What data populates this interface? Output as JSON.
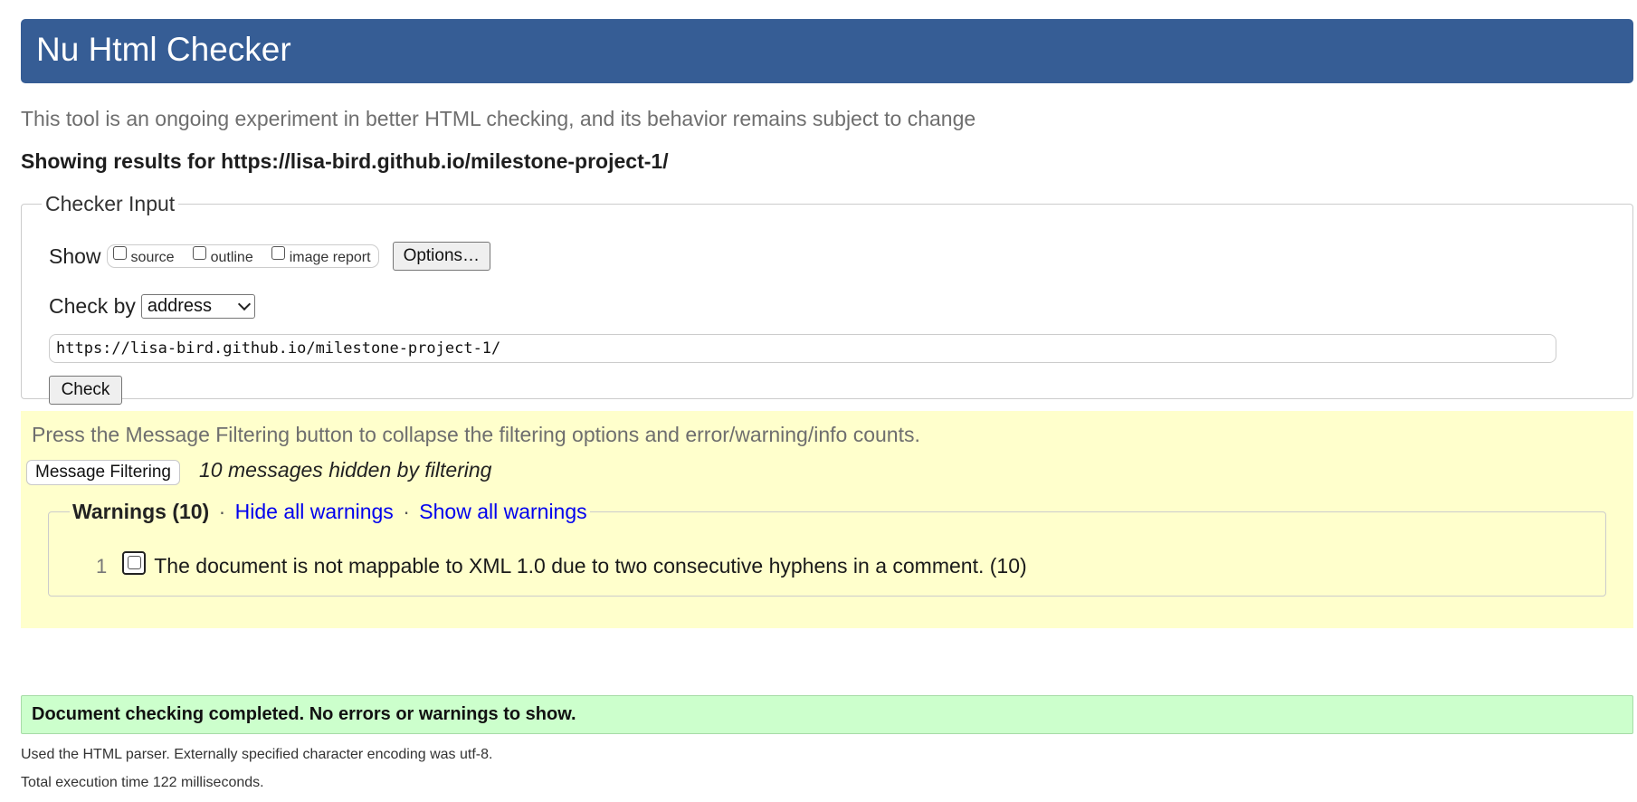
{
  "header": {
    "title": "Nu Html Checker"
  },
  "tagline": "This tool is an ongoing experiment in better HTML checking, and its behavior remains subject to change",
  "results_heading": "Showing results for https://lisa-bird.github.io/milestone-project-1/",
  "checker_input": {
    "legend": "Checker Input",
    "show_label": "Show",
    "show_options": [
      {
        "label": "source",
        "checked": false
      },
      {
        "label": "outline",
        "checked": false
      },
      {
        "label": "image report",
        "checked": false
      }
    ],
    "options_button": "Options…",
    "check_by_label": "Check by",
    "check_by_selected": "address",
    "url_value": "https://lisa-bird.github.io/milestone-project-1/",
    "check_button": "Check"
  },
  "filtering": {
    "hint": "Press the Message Filtering button to collapse the filtering options and error/warning/info counts.",
    "button": "Message Filtering",
    "hidden_count": "10 messages hidden by filtering",
    "warnings_title": "Warnings (10)",
    "separator": "·",
    "hide_all": "Hide all warnings",
    "show_all": "Show all warnings",
    "items": [
      {
        "number": "1",
        "text": "The document is not mappable to XML 1.0 due to two consecutive hyphens in a comment. (10)",
        "checked": false
      }
    ]
  },
  "status": {
    "message": "Document checking completed. No errors or warnings to show.",
    "parser_note": "Used the HTML parser. Externally specified character encoding was utf-8.",
    "execution_time": "Total execution time 122 milliseconds."
  },
  "colors": {
    "header_bg": "#365d95",
    "filter_bg": "#ffffcc",
    "success_bg": "#ccffcc",
    "link": "#0000ee"
  }
}
